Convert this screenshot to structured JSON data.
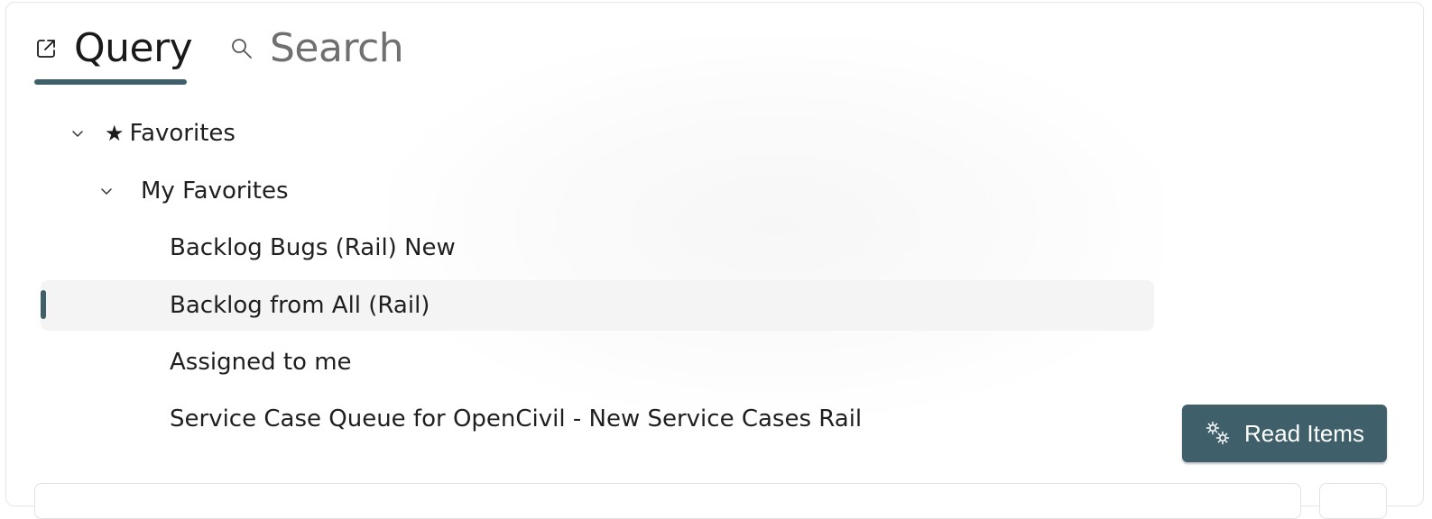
{
  "tabs": {
    "query": {
      "label": "Query",
      "icon": "open-external-icon",
      "active": true
    },
    "search": {
      "label": "Search",
      "icon": "search-icon",
      "active": false
    }
  },
  "tree": {
    "favorites": {
      "label": "Favorites",
      "icon": "star-icon",
      "expanded": true
    },
    "my_favorites": {
      "label": "My Favorites",
      "expanded": true
    },
    "items": [
      {
        "label": "Backlog Bugs (Rail) New",
        "selected": false
      },
      {
        "label": "Backlog from All (Rail)",
        "selected": true
      },
      {
        "label": "Assigned to me",
        "selected": false
      },
      {
        "label": "Service Case Queue for OpenCivil - New Service Cases Rail",
        "selected": false
      }
    ]
  },
  "actions": {
    "read_items": {
      "label": "Read Items",
      "icon": "gears-icon"
    }
  },
  "colors": {
    "accent": "#3f5f6b",
    "selected_background": "#f4f4f4",
    "tab_inactive_text": "#707070",
    "text": "#1f1f1f"
  }
}
